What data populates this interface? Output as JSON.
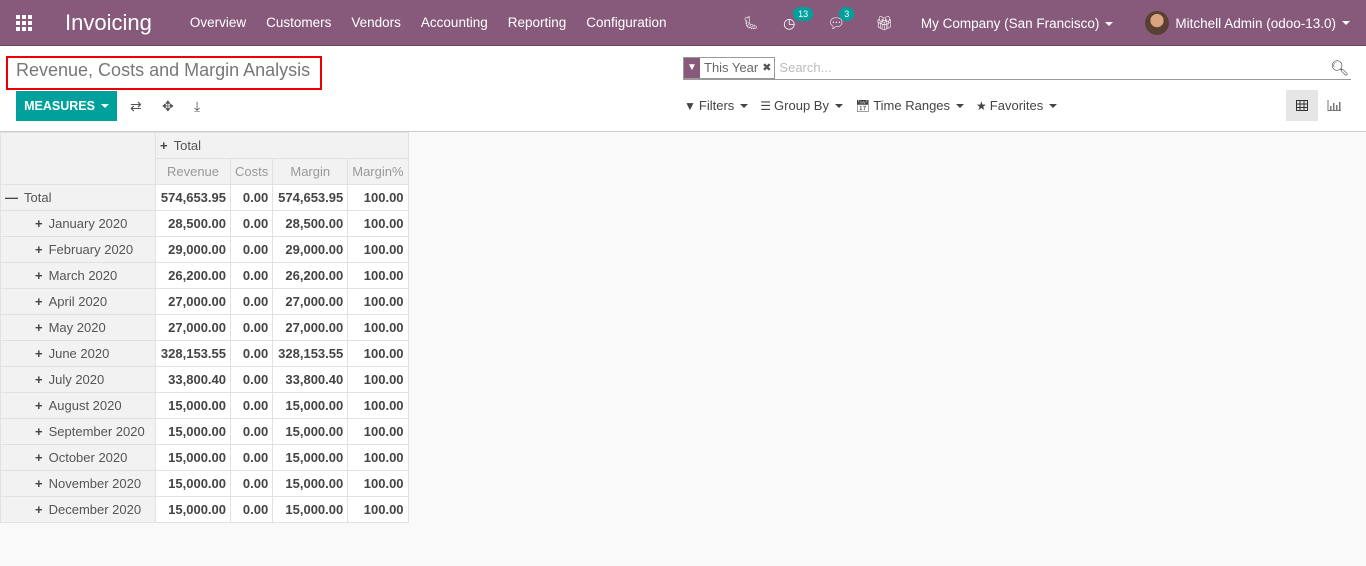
{
  "navbar": {
    "app_name": "Invoicing",
    "menu": [
      "Overview",
      "Customers",
      "Vendors",
      "Accounting",
      "Reporting",
      "Configuration"
    ],
    "activity_count": "13",
    "message_count": "3",
    "company": "My Company (San Francisco)",
    "user": "Mitchell Admin (odoo-13.0)"
  },
  "control": {
    "title": "Revenue, Costs and Margin Analysis",
    "measures_label": "MEASURES",
    "search": {
      "facet_value": "This Year",
      "placeholder": "Search..."
    },
    "filters_label": "Filters",
    "group_by_label": "Group By",
    "time_ranges_label": "Time Ranges",
    "favorites_label": "Favorites"
  },
  "pivot": {
    "col_header": "Total",
    "measures": [
      "Revenue",
      "Costs",
      "Margin",
      "Margin%"
    ],
    "total_row": {
      "label": "Total",
      "values": [
        "574,653.95",
        "0.00",
        "574,653.95",
        "100.00"
      ]
    },
    "rows": [
      {
        "label": "January 2020",
        "values": [
          "28,500.00",
          "0.00",
          "28,500.00",
          "100.00"
        ]
      },
      {
        "label": "February 2020",
        "values": [
          "29,000.00",
          "0.00",
          "29,000.00",
          "100.00"
        ]
      },
      {
        "label": "March 2020",
        "values": [
          "26,200.00",
          "0.00",
          "26,200.00",
          "100.00"
        ]
      },
      {
        "label": "April 2020",
        "values": [
          "27,000.00",
          "0.00",
          "27,000.00",
          "100.00"
        ]
      },
      {
        "label": "May 2020",
        "values": [
          "27,000.00",
          "0.00",
          "27,000.00",
          "100.00"
        ]
      },
      {
        "label": "June 2020",
        "values": [
          "328,153.55",
          "0.00",
          "328,153.55",
          "100.00"
        ]
      },
      {
        "label": "July 2020",
        "values": [
          "33,800.40",
          "0.00",
          "33,800.40",
          "100.00"
        ]
      },
      {
        "label": "August 2020",
        "values": [
          "15,000.00",
          "0.00",
          "15,000.00",
          "100.00"
        ]
      },
      {
        "label": "September 2020",
        "values": [
          "15,000.00",
          "0.00",
          "15,000.00",
          "100.00"
        ]
      },
      {
        "label": "October 2020",
        "values": [
          "15,000.00",
          "0.00",
          "15,000.00",
          "100.00"
        ]
      },
      {
        "label": "November 2020",
        "values": [
          "15,000.00",
          "0.00",
          "15,000.00",
          "100.00"
        ]
      },
      {
        "label": "December 2020",
        "values": [
          "15,000.00",
          "0.00",
          "15,000.00",
          "100.00"
        ]
      }
    ]
  }
}
